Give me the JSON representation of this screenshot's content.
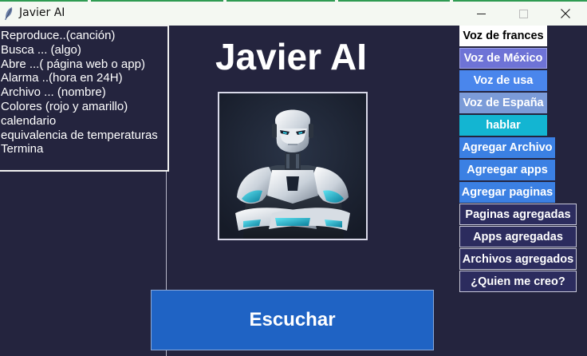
{
  "window": {
    "title": "Javier AI",
    "minimize_icon": "minimize-icon",
    "maximize_icon": "maximize-icon",
    "close_icon": "close-icon"
  },
  "menu": {
    "items": [
      "Reproduce..(canción)",
      "Busca ... (algo)",
      "Abre ...( página web o app)",
      "Alarma ..(hora en 24H)",
      "Archivo ... (nombre)",
      "Colores (rojo y amarillo)",
      "calendario",
      "equivalencia de temperaturas",
      "Termina"
    ]
  },
  "main": {
    "title": "Javier AI",
    "image": "robot-image",
    "listen_label": "Escuchar"
  },
  "buttons": {
    "voice_french": "Voz de frances",
    "voice_mexico": "Voz de México",
    "voice_usa": "Voz de usa",
    "voice_spain": "Voz de España",
    "speak": "hablar",
    "add_file": "Agregar Archivo",
    "add_apps": "Agreegar apps",
    "add_pages": "Agregar paginas",
    "pages_added": "Paginas agregadas",
    "apps_added": "Apps agregadas",
    "files_added": "Archivos agregados",
    "who_made_me": "¿Quien me creo?"
  },
  "colors": {
    "background": "#24243e",
    "voice_french": "#ffffff",
    "voice_mexico": "#6e73d6",
    "voice_usa": "#4a86ec",
    "voice_spain": "#7b9bd8",
    "speak": "#13b5d2",
    "add_buttons": "#3b80e3",
    "added_buttons": "#2c2c5e",
    "listen": "#1f63c4"
  }
}
